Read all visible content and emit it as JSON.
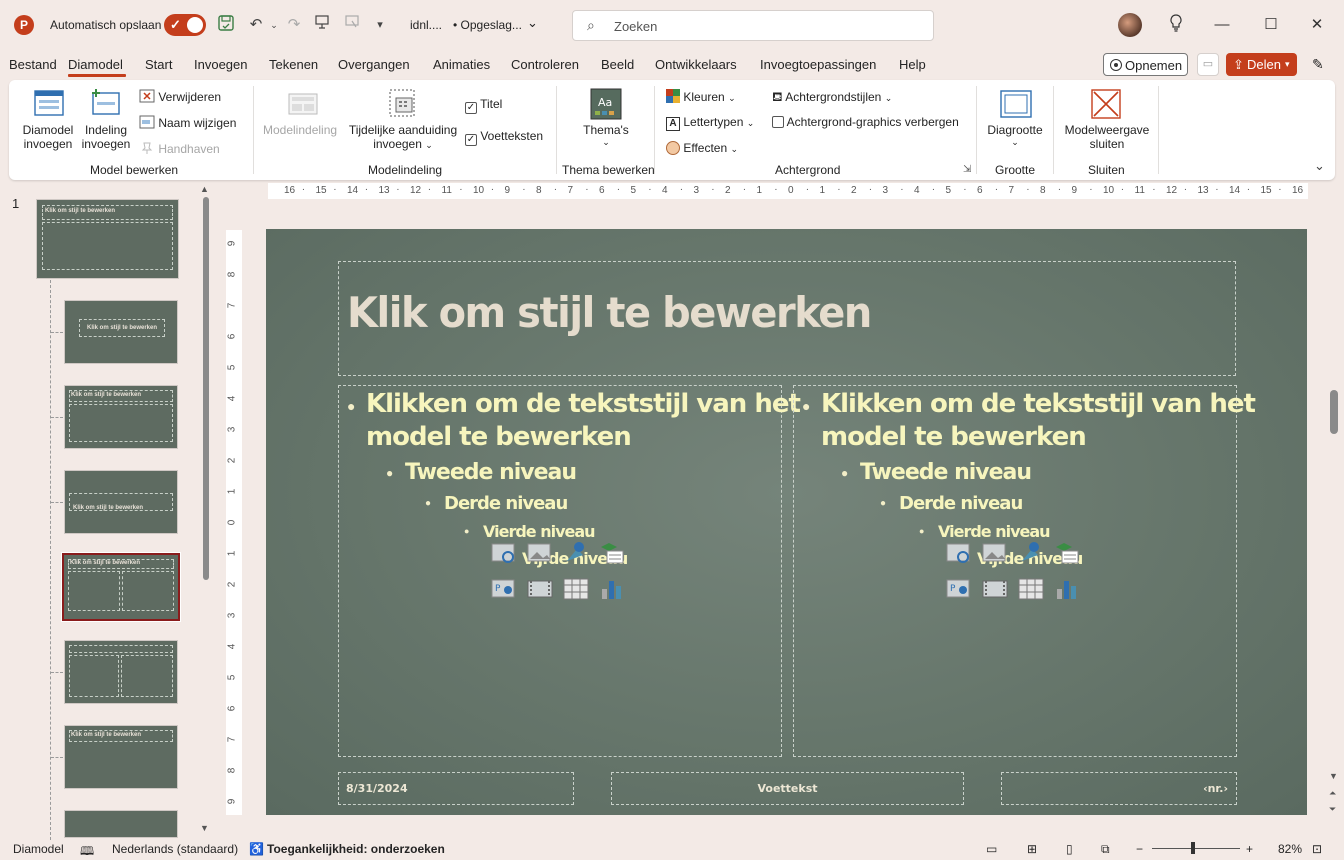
{
  "titlebar": {
    "autosave_label": "Automatisch opslaan",
    "filename": "idnl....",
    "save_status": "• Opgeslag...",
    "search_placeholder": "Zoeken"
  },
  "tabs": [
    "Bestand",
    "Diamodel",
    "Start",
    "Invoegen",
    "Tekenen",
    "Overgangen",
    "Animaties",
    "Controleren",
    "Beeld",
    "Ontwikkelaars",
    "Invoegtoepassingen",
    "Help"
  ],
  "active_tab": "Diamodel",
  "actions": {
    "record": "Opnemen",
    "share": "Delen"
  },
  "ribbon": {
    "g1": {
      "insert_master_l1": "Diamodel",
      "insert_master_l2": "invoegen",
      "insert_layout_l1": "Indeling",
      "insert_layout_l2": "invoegen",
      "delete": "Verwijderen",
      "rename": "Naam wijzigen",
      "preserve": "Handhaven",
      "label": "Model bewerken"
    },
    "g2": {
      "master_layout": "Modelindeling",
      "placeholder_l1": "Tijdelijke aanduiding",
      "placeholder_l2": "invoegen",
      "title_cb": "Titel",
      "footers_cb": "Voetteksten",
      "label": "Modelindeling"
    },
    "g3": {
      "themes": "Thema's",
      "label": "Thema bewerken"
    },
    "g4": {
      "colors": "Kleuren",
      "fonts": "Lettertypen",
      "effects": "Effecten",
      "bg_styles": "Achtergrondstijlen",
      "hide_bg": "Achtergrond-graphics verbergen",
      "label": "Achtergrond"
    },
    "g5": {
      "slide_size": "Diagrootte",
      "label": "Grootte"
    },
    "g6": {
      "close_l1": "Modelweergave",
      "close_l2": "sluiten",
      "label": "Sluiten"
    }
  },
  "slide_number": "1",
  "thumb_title": "Klik om stijl te bewerken",
  "ruler_h": [
    "16",
    "15",
    "14",
    "13",
    "12",
    "11",
    "10",
    "9",
    "8",
    "7",
    "6",
    "5",
    "4",
    "3",
    "2",
    "1",
    "0",
    "1",
    "2",
    "3",
    "4",
    "5",
    "6",
    "7",
    "8",
    "9",
    "10",
    "11",
    "12",
    "13",
    "14",
    "15",
    "16"
  ],
  "ruler_v": [
    "9",
    "8",
    "7",
    "6",
    "5",
    "4",
    "3",
    "2",
    "1",
    "0",
    "1",
    "2",
    "3",
    "4",
    "5",
    "6",
    "7",
    "8",
    "9"
  ],
  "slide": {
    "title": "Klik om stijl te bewerken",
    "level1_a": "Klikken om de tekststijl van het",
    "level1_b": "model te bewerken",
    "level2": "Tweede niveau",
    "level3": "Derde niveau",
    "level4": "Vierde niveau",
    "level5": "Vijfde niveau",
    "date": "8/31/2024",
    "footer": "Voettekst",
    "page_num": "‹nr.›"
  },
  "colors": {
    "accent": "#c43e1c",
    "slide_bg": "#66766b",
    "title_text": "#e5dccd",
    "body_text": "#f7f5bd"
  },
  "status": {
    "view": "Diamodel",
    "language": "Nederlands (standaard)",
    "accessibility": "Toegankelijkheid: onderzoeken",
    "zoom": "82%"
  }
}
